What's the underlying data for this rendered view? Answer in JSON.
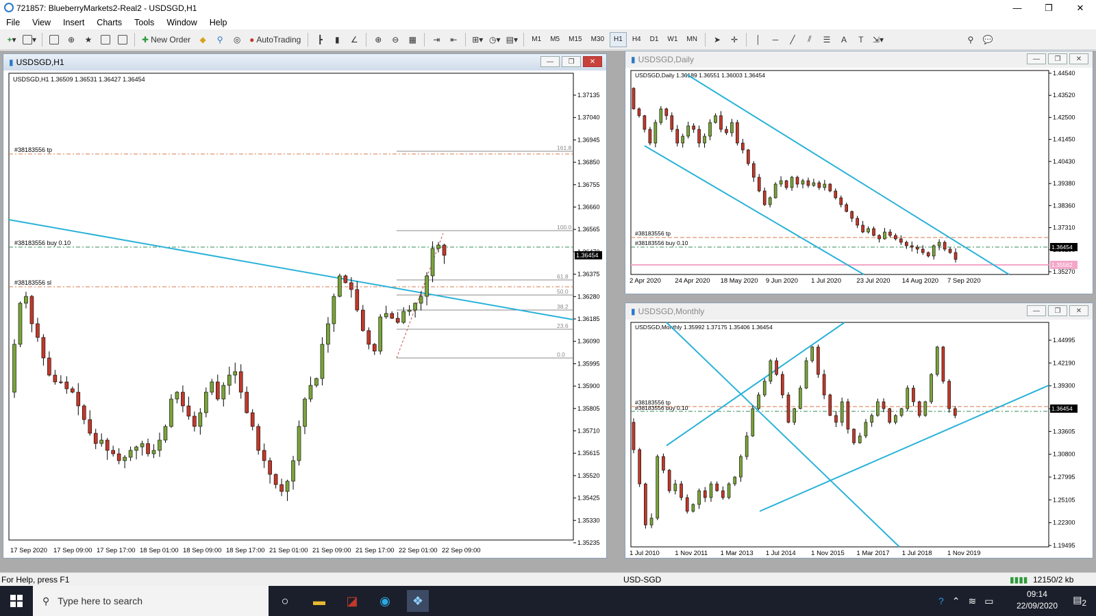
{
  "app": {
    "title": "721857: BlueberryMarkets2-Real2 - USDSGD,H1"
  },
  "menu": [
    "File",
    "View",
    "Insert",
    "Charts",
    "Tools",
    "Window",
    "Help"
  ],
  "toolbar": {
    "new_order": "New Order",
    "autotrading": "AutoTrading",
    "timeframes": [
      "M1",
      "M5",
      "M15",
      "M30",
      "H1",
      "H4",
      "D1",
      "W1",
      "MN"
    ],
    "active_timeframe": "H1"
  },
  "charts": {
    "h1": {
      "window_title": "USDSGD,H1",
      "info": "USDSGD,H1  1.36509 1.36531 1.36427 1.36454",
      "price_labels": [
        "1.37135",
        "1.37040",
        "1.36945",
        "1.36850",
        "1.36755",
        "1.36660",
        "1.36565",
        "1.36470",
        "1.36375",
        "1.36280",
        "1.36185",
        "1.36090",
        "1.35995",
        "1.35900",
        "1.35805",
        "1.35710",
        "1.35615",
        "1.35520",
        "1.35425",
        "1.35330",
        "1.35235"
      ],
      "current_price": "1.36454",
      "time_labels": [
        "17 Sep 2020",
        "17 Sep 09:00",
        "17 Sep 17:00",
        "18 Sep 01:00",
        "18 Sep 09:00",
        "18 Sep 17:00",
        "21 Sep 01:00",
        "21 Sep 09:00",
        "21 Sep 17:00",
        "22 Sep 01:00",
        "22 Sep 09:00"
      ],
      "order_lines": {
        "tp": "#38183556 tp",
        "buy": "#38183556 buy 0.10",
        "sl": "#38183556 sl"
      },
      "fib_levels": [
        "161.8",
        "100.0",
        "61.8",
        "50.0",
        "38.2",
        "23.6",
        "0.0"
      ]
    },
    "daily": {
      "window_title": "USDSGD,Daily",
      "info": "USDSGD,Daily  1.36189 1.36551 1.36003 1.36454",
      "price_labels": [
        "1.44540",
        "1.43520",
        "1.42500",
        "1.41450",
        "1.40430",
        "1.39380",
        "1.38360",
        "1.37310",
        "1.36290",
        "1.35270"
      ],
      "current_price": "1.36454",
      "extra_price": "1.35562",
      "time_labels": [
        "2 Apr 2020",
        "24 Apr 2020",
        "18 May 2020",
        "9 Jun 2020",
        "1 Jul 2020",
        "23 Jul 2020",
        "14 Aug 2020",
        "7 Sep 2020"
      ],
      "order_tp": "#38183556 tp",
      "order_buy": "#38183556 buy 0.10"
    },
    "monthly": {
      "window_title": "USDSGD,Monthly",
      "info": "USDSGD,Monthly  1.35992 1.37175 1.35406 1.36454",
      "price_labels": [
        "1.44995",
        "1.42190",
        "1.39300",
        "1.36454",
        "1.33605",
        "1.30800",
        "1.27995",
        "1.25105",
        "1.22300",
        "1.19495"
      ],
      "current_price": "1.36454",
      "time_labels": [
        "1 Jul 2010",
        "1 Nov 2011",
        "1 Mar 2013",
        "1 Jul 2014",
        "1 Nov 2015",
        "1 Mar 2017",
        "1 Jul 2018",
        "1 Nov 2019"
      ],
      "order_tp": "#38183556 tp",
      "order_buy": "#38183556 buy 0.10"
    }
  },
  "status": {
    "help": "For Help, press F1",
    "symbol": "USD-SGD",
    "traffic": "12150/2 kb"
  },
  "taskbar": {
    "search_placeholder": "Type here to search",
    "time": "09:14",
    "date": "22/09/2020",
    "notif_count": "2"
  },
  "colors": {
    "bull": "#7aa33a",
    "bear": "#c0392b",
    "trendline": "#29b2d8",
    "tp_line": "#d67a4a",
    "buy_line": "#2e8b57",
    "sl_line": "#d67a4a",
    "pink": "#f3a6c8"
  }
}
